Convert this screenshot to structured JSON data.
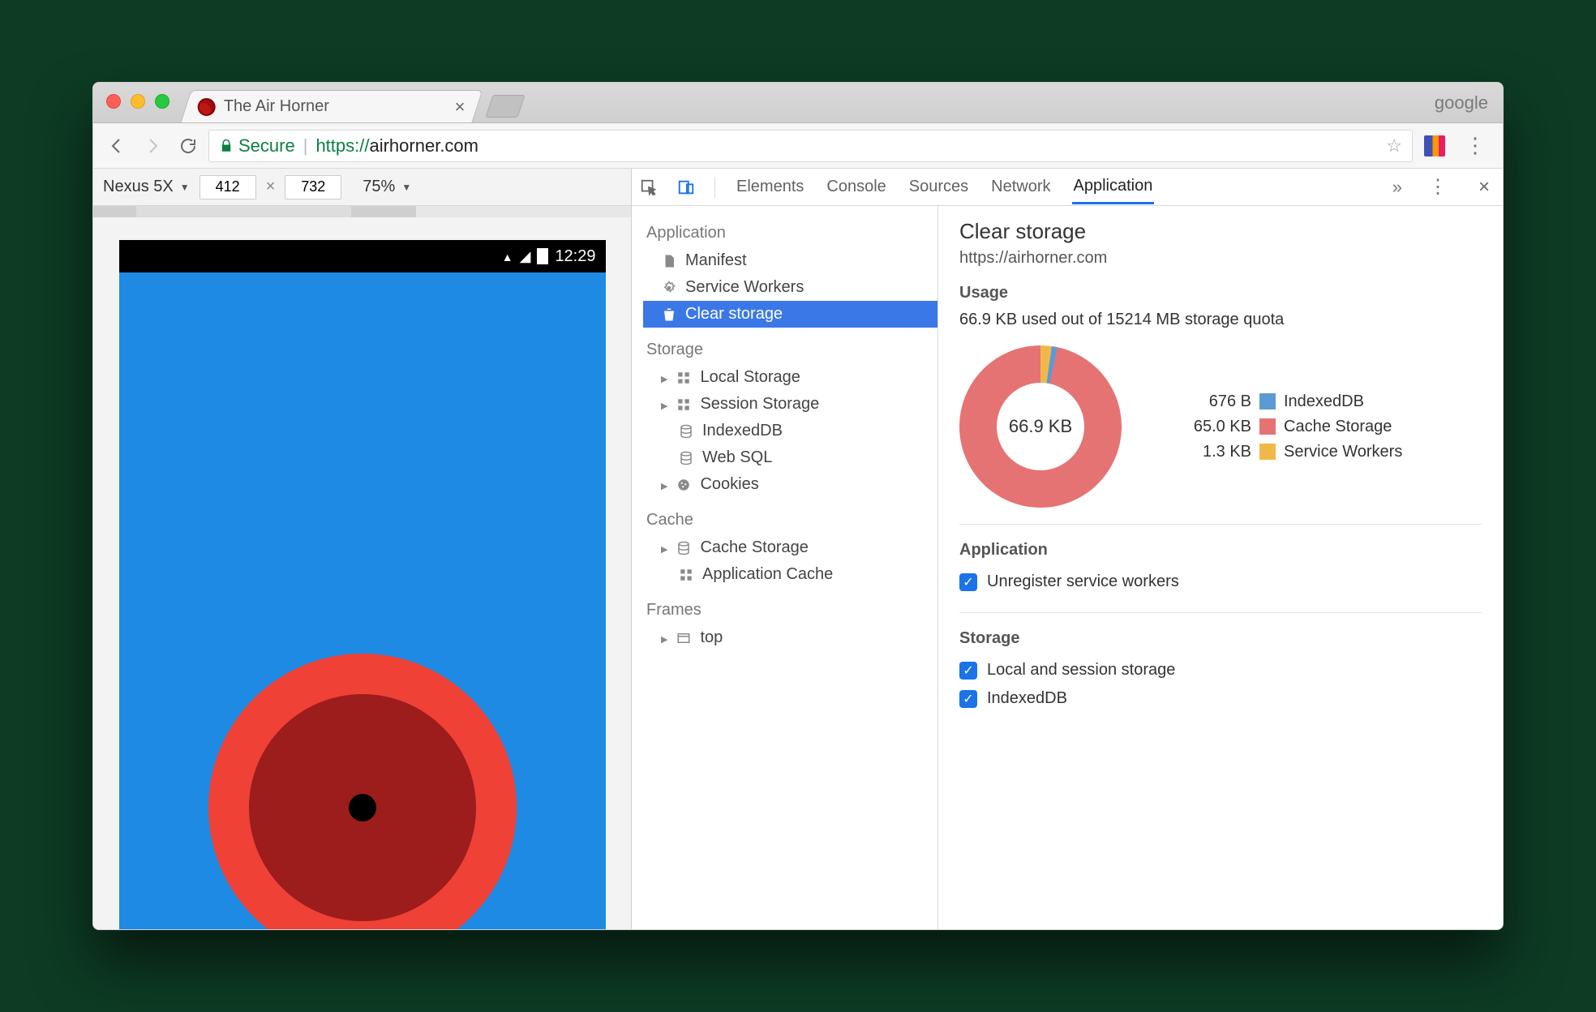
{
  "browser": {
    "tab_title": "The Air Horner",
    "profile_label": "google",
    "secure_label": "Secure",
    "url_proto": "https://",
    "url_host": "airhorner.com",
    "url_path": ""
  },
  "device_toolbar": {
    "device": "Nexus 5X",
    "width": "412",
    "height": "732",
    "zoom": "75%",
    "clock": "12:29"
  },
  "devtools": {
    "tabs": [
      "Elements",
      "Console",
      "Sources",
      "Network",
      "Application"
    ],
    "active_tab": "Application",
    "sidebar": {
      "groups": [
        {
          "title": "Application",
          "items": [
            {
              "key": "manifest",
              "label": "Manifest"
            },
            {
              "key": "service-workers",
              "label": "Service Workers"
            },
            {
              "key": "clear-storage",
              "label": "Clear storage",
              "selected": true
            }
          ]
        },
        {
          "title": "Storage",
          "items": [
            {
              "key": "local-storage",
              "label": "Local Storage",
              "expand": true
            },
            {
              "key": "session-storage",
              "label": "Session Storage",
              "expand": true
            },
            {
              "key": "indexeddb",
              "label": "IndexedDB"
            },
            {
              "key": "websql",
              "label": "Web SQL"
            },
            {
              "key": "cookies",
              "label": "Cookies",
              "expand": true
            }
          ]
        },
        {
          "title": "Cache",
          "items": [
            {
              "key": "cache-storage",
              "label": "Cache Storage",
              "expand": true
            },
            {
              "key": "app-cache",
              "label": "Application Cache"
            }
          ]
        },
        {
          "title": "Frames",
          "items": [
            {
              "key": "top",
              "label": "top",
              "expand": true
            }
          ]
        }
      ]
    },
    "main": {
      "title": "Clear storage",
      "origin": "https://airhorner.com",
      "usage_heading": "Usage",
      "usage_text": "66.9 KB used out of 15214 MB storage quota",
      "donut_center": "66.9 KB",
      "app_heading": "Application",
      "storage_heading": "Storage",
      "checks": {
        "unregister_sw": "Unregister service workers",
        "local_session": "Local and session storage",
        "indexeddb": "IndexedDB"
      }
    }
  },
  "chart_data": {
    "type": "pie",
    "title": "Storage usage breakdown",
    "total_label": "66.9 KB",
    "series": [
      {
        "name": "IndexedDB",
        "value_label": "676 B",
        "value_bytes": 676,
        "color": "#5b9bd5"
      },
      {
        "name": "Cache Storage",
        "value_label": "65.0 KB",
        "value_bytes": 66560,
        "color": "#e57373"
      },
      {
        "name": "Service Workers",
        "value_label": "1.3 KB",
        "value_bytes": 1331,
        "color": "#f0b84b"
      }
    ]
  }
}
